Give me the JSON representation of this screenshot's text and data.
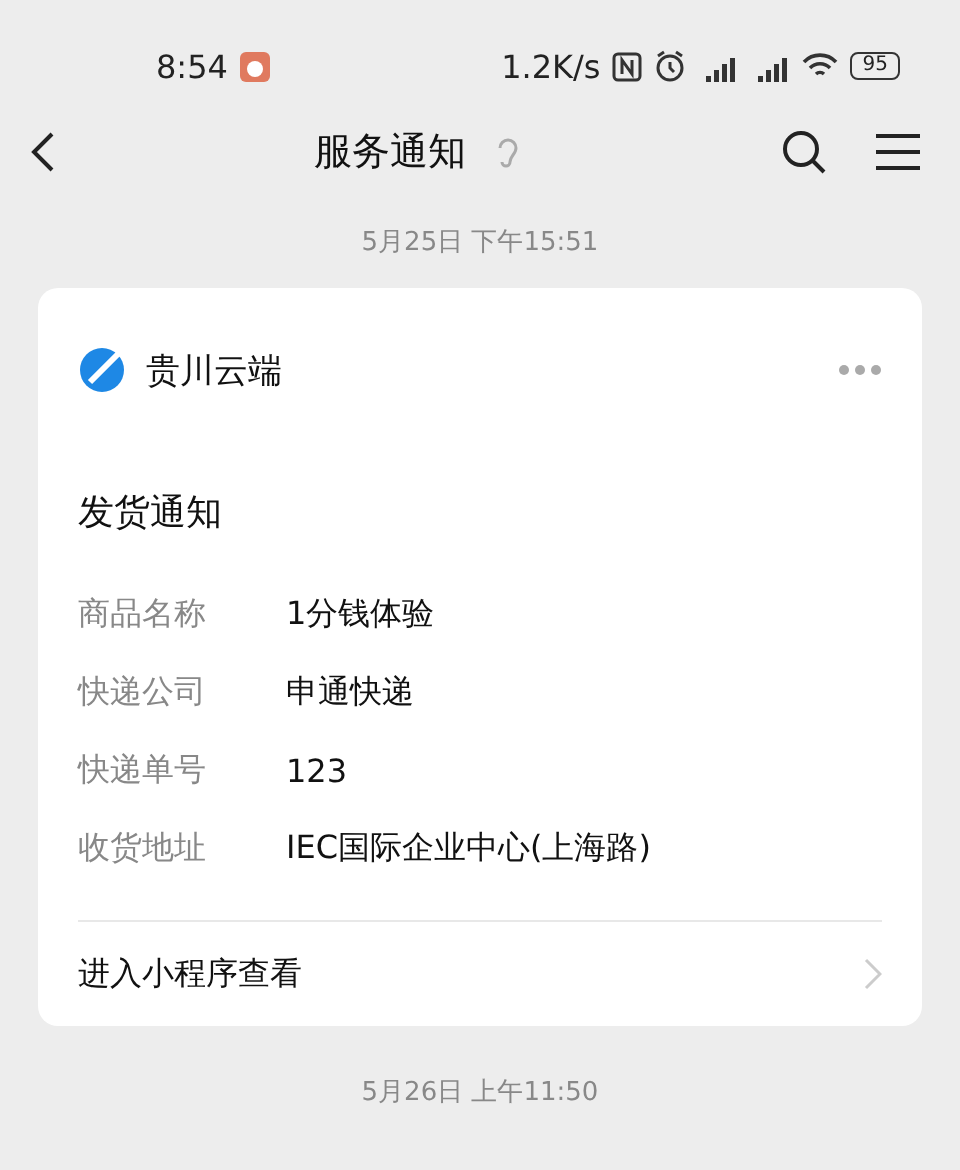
{
  "status_bar": {
    "time": "8:54",
    "speed": "1.2K/s",
    "battery": "95"
  },
  "nav": {
    "title": "服务通知"
  },
  "messages": [
    {
      "timestamp": "5月25日 下午15:51",
      "brand": "贵川云端",
      "title": "发货通知",
      "fields": [
        {
          "label": "商品名称",
          "value": "1分钱体验"
        },
        {
          "label": "快递公司",
          "value": "申通快递"
        },
        {
          "label": "快递单号",
          "value": "123"
        },
        {
          "label": "收货地址",
          "value": "IEC国际企业中心(上海路)"
        }
      ],
      "link": "进入小程序查看"
    }
  ],
  "next_timestamp": "5月26日 上午11:50"
}
